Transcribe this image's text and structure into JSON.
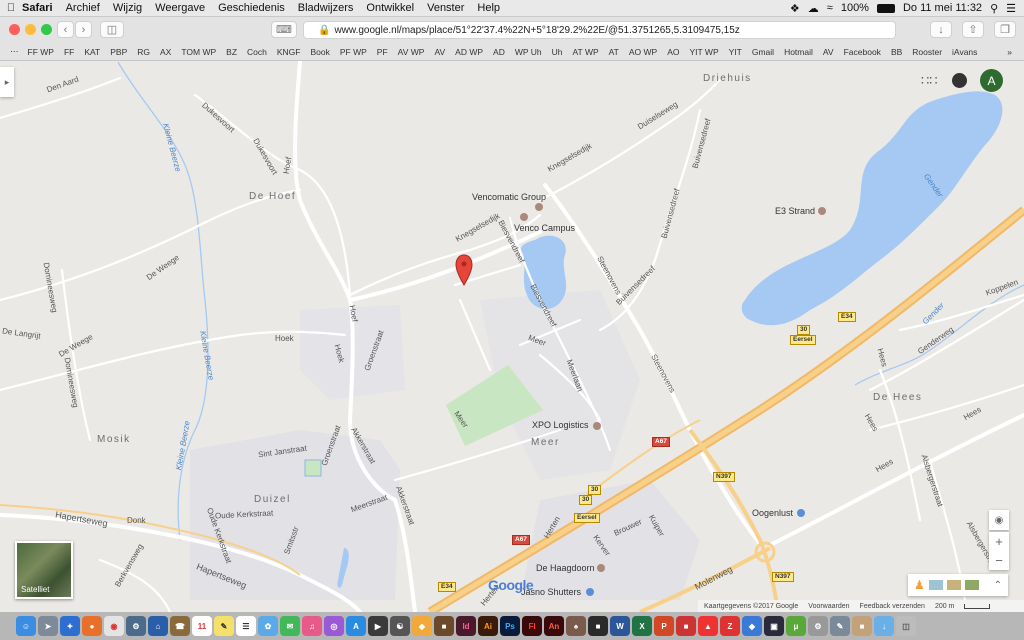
{
  "menubar": {
    "app": "Safari",
    "items": [
      "Archief",
      "Wijzig",
      "Weergave",
      "Geschiedenis",
      "Bladwijzers",
      "Ontwikkel",
      "Venster",
      "Help"
    ],
    "battery": "100%",
    "clock": "Do 11 mei  11:32"
  },
  "browser": {
    "url": "www.google.nl/maps/place/51°22'37.4%22N+5°18'29.2%22E/@51.3751265,5.3109475,15z"
  },
  "bookmarks": [
    "FF WP",
    "FF",
    "KAT",
    "PBP",
    "RG",
    "AX",
    "TOM WP",
    "BZ",
    "Coch",
    "KNGF",
    "Book",
    "PF WP",
    "PF",
    "AV WP",
    "AV",
    "AD WP",
    "AD",
    "WP Uh",
    "Uh",
    "AT WP",
    "AT",
    "AO WP",
    "AO",
    "YIT WP",
    "YIT",
    "Gmail",
    "Hotmail",
    "AV",
    "Facebook",
    "BB",
    "Rooster",
    "iAvans"
  ],
  "map": {
    "towns": {
      "drie": "Driehuis",
      "hoef": "De Hoef",
      "mosik": "Mosik",
      "duizel": "Duizel",
      "meer": "Meer",
      "hees": "De Hees"
    },
    "pois": {
      "vencomatic": "Vencomatic Group",
      "venco": "Venco Campus",
      "e3": "E3 Strand",
      "xpo": "XPO Logistics",
      "oogenlust": "Oogenlust",
      "haagdoorn": "De Haagdoorn",
      "shutters": "Jasno Shutters"
    },
    "streets": {
      "denaard": "Den Aard",
      "dukesvoort": "Dukesvoort",
      "dukesvoort2": "Dukesvoort",
      "duiselseweg": "Duiselseweg",
      "knegselsedijk": "Knegselsedijk",
      "knegselsedijk2": "Knegselsedijk",
      "buivensedreef": "Buivensedreef",
      "buivensedreef2": "Buivensedreef",
      "biesvenstreef": "Biesvendreef",
      "biesvenstreef2": "Biesvendreef",
      "steenovens": "Steenovens",
      "steenovens2": "Steenovens",
      "hoef": "Hoef",
      "hoef2": "Hoef",
      "deweege": "De Weege",
      "dominee": "Domineesweg",
      "dominee2": "Domineesweg",
      "langrijt": "De Langrijt",
      "deweege2": "De Weege",
      "hoek": "Hoek",
      "hoek2": "Hoek",
      "groenstraat": "Groenstraat",
      "groenstraat2": "Groenstraat",
      "meerstraat": "Meerstraat",
      "akkerstraat": "Akkerstraat",
      "akkerstraat2": "Akkerstraat",
      "janstraat": "Sint Janstraat",
      "oudekerk": "Oude Kerkstraat",
      "hapertseweg": "Hapertseweg",
      "hapertseweg2": "Hapertseweg",
      "donk": "Donk",
      "meerweg": "Meer",
      "meer2": "Meer",
      "merelaan": "Meerlaan",
      "koppelen": "Koppelen",
      "genderweg": "Genderweg",
      "hees1": "Hees",
      "hees2": "Hees",
      "hees3": "Hees",
      "albergerstr": "Alsbergerstraat",
      "albergerstr2": "Alsbergerstraat",
      "herten": "Herten",
      "kerver": "Kerver",
      "brouwer": "Brouwer",
      "kuiper": "Kuiper",
      "molenweg": "Molenweg",
      "berkvensweg": "Berkvensweg",
      "smitsstr": "Smitsstr",
      "kleinebeerze": "Kleine Beerze",
      "kleinebeerze2": "Kleine Beerze",
      "kleinebeerze3": "Kleine Beerze",
      "gender": "Gender",
      "gender2": "Gender",
      "e34": "E34",
      "e34b": "E34",
      "a67": "A67",
      "a67b": "A67",
      "n397": "N397",
      "n397b": "N397",
      "r30a": "30",
      "r30b": "30",
      "r30c": "30",
      "eersel": "Eersel",
      "eersel2": "Eersel"
    },
    "satellite_label": "Satelliet",
    "account_initial": "A",
    "footer": {
      "data": "Kaartgegevens ©2017 Google",
      "terms": "Voorwaarden",
      "feedback": "Feedback verzenden",
      "scale": "200 m"
    },
    "zoom_in": "+",
    "zoom_out": "−",
    "google": "Google"
  }
}
